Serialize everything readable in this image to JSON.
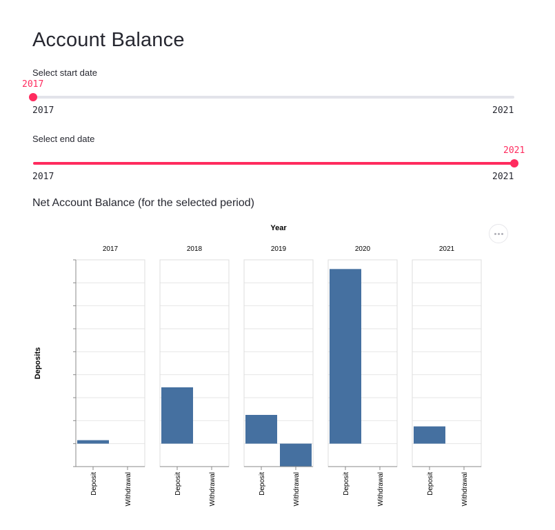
{
  "page": {
    "title": "Account Balance"
  },
  "accent_color": "#ff2b5e",
  "start_slider": {
    "label": "Select start date",
    "value": "2017",
    "min_label": "2017",
    "max_label": "2021"
  },
  "end_slider": {
    "label": "Select end date",
    "value": "2021",
    "min_label": "2017",
    "max_label": "2021"
  },
  "section": {
    "title": "Net Account Balance (for the selected period)"
  },
  "chart_menu": {
    "icon": "more-horizontal-icon"
  },
  "chart_data": {
    "type": "bar",
    "column_title": "Year",
    "ylabel": "Deposits",
    "facets": [
      "2017",
      "2018",
      "2019",
      "2020",
      "2021"
    ],
    "categories": [
      "Deposit",
      "Withdrawal"
    ],
    "values": [
      [
        0.3,
        0
      ],
      [
        4.9,
        0
      ],
      [
        2.5,
        -2.0
      ],
      [
        15.2,
        0
      ],
      [
        1.5,
        0
      ]
    ],
    "ylim": [
      -2,
      16
    ],
    "grid": true,
    "bar_color": "#4570a0"
  }
}
